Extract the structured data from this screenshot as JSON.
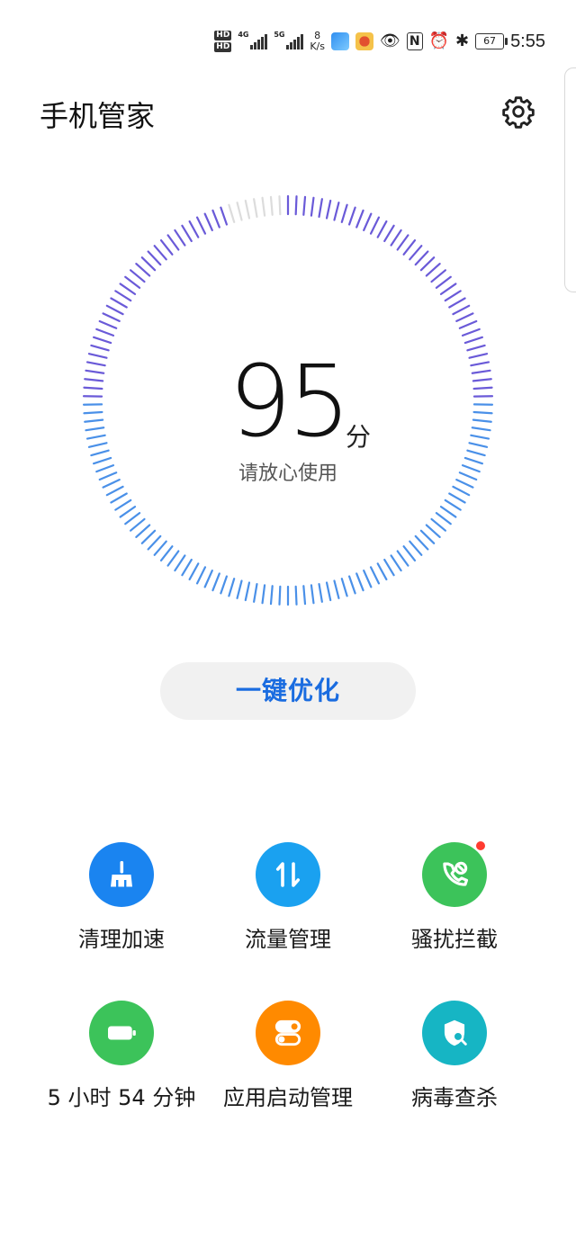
{
  "status_bar": {
    "hd1": "HD",
    "hd2": "HD",
    "net1": "4G",
    "net2": "5G",
    "speed_value": "8",
    "speed_unit": "K/s",
    "battery": "67",
    "time": "5:55"
  },
  "header": {
    "title": "手机管家"
  },
  "score": {
    "value": "95",
    "unit": "分",
    "subtitle": "请放心使用"
  },
  "optimize_button": {
    "label": "一键优化"
  },
  "features": [
    {
      "label": "清理加速",
      "color": "#1a84f0",
      "icon": "broom-icon"
    },
    {
      "label": "流量管理",
      "color": "#1aa1f0",
      "icon": "data-transfer-icon"
    },
    {
      "label": "骚扰拦截",
      "color": "#3cc35a",
      "icon": "phone-block-icon"
    },
    {
      "label": "5 小时 54 分钟",
      "color": "#3cc35a",
      "icon": "battery-icon"
    },
    {
      "label": "应用启动管理",
      "color": "#ff8a00",
      "icon": "toggle-icon"
    },
    {
      "label": "病毒查杀",
      "color": "#16b5c4",
      "icon": "shield-search-icon"
    }
  ],
  "colors": {
    "accent": "#1a6ce0",
    "gauge_light": "#4a90e8",
    "gauge_dark": "#6a5ad8"
  }
}
